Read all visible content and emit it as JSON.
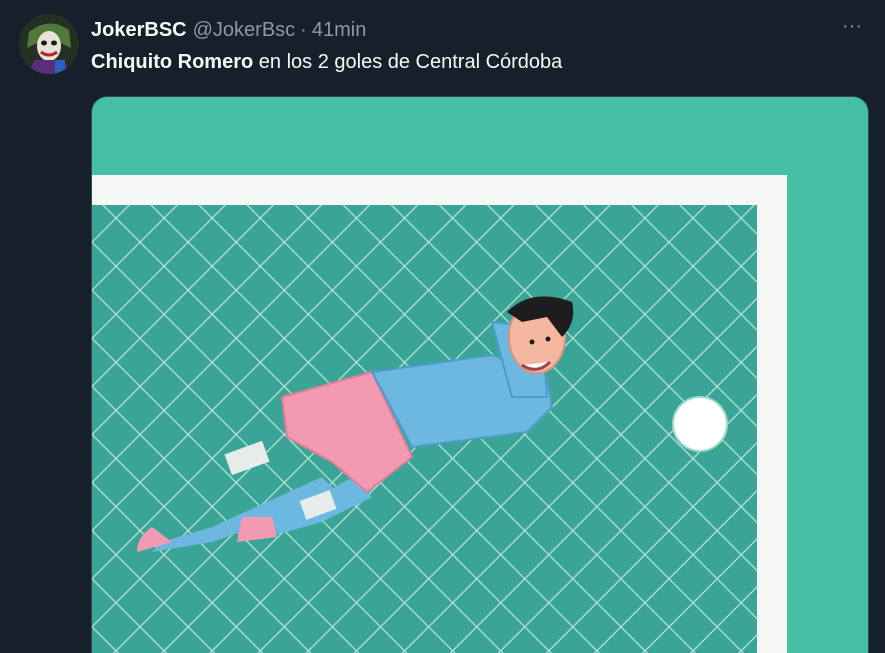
{
  "author": {
    "display_name": "JokerBSC",
    "handle": "@JokerBsc",
    "separator": "·",
    "time": "41min",
    "avatar_icon": "joker-avatar-icon"
  },
  "more_label": "···",
  "tweet": {
    "bold_text": "Chiquito Romero",
    "text": " en los 2 goles de Central Córdoba"
  },
  "media": {
    "kind": "illustration",
    "colors": {
      "pitch": "#45bfa6",
      "net_bg": "#3aa596",
      "goal_line": "#f4f7f3",
      "shirt": "#6cb8e0",
      "shorts": "#f39ab3",
      "ball": "#ffffff"
    }
  },
  "theme": {
    "background": "#15202b",
    "primary_text": "#f7f9f9",
    "secondary_text": "#8b98a5"
  }
}
